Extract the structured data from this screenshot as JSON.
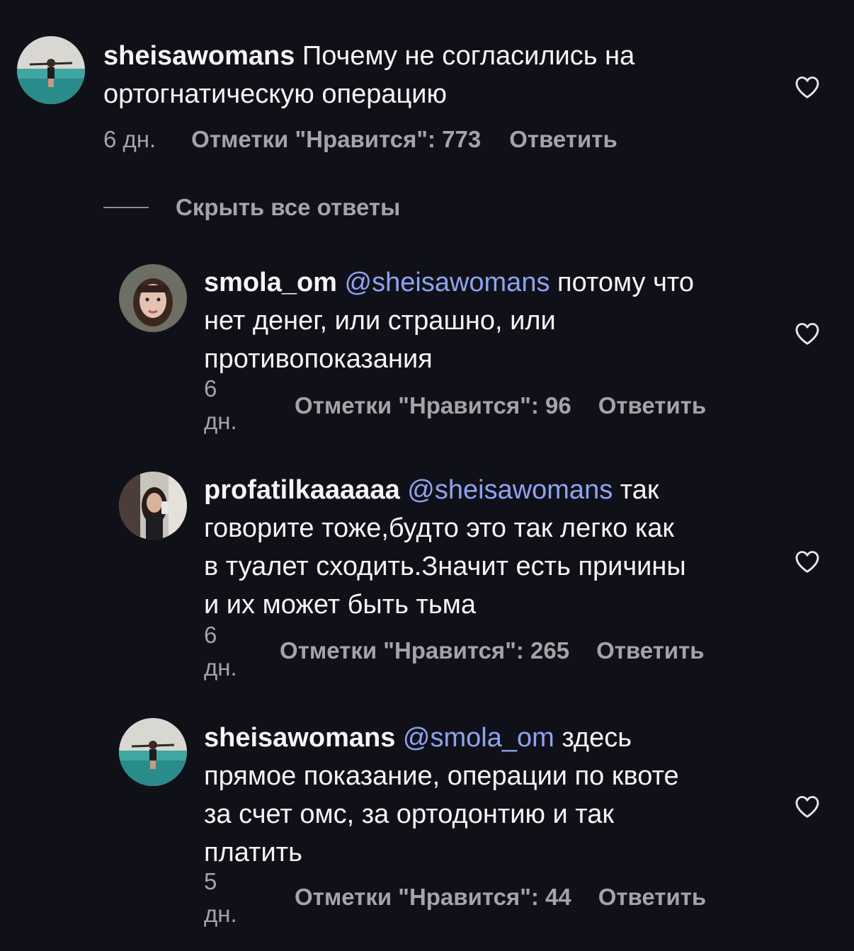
{
  "colors": {
    "background": "#101118",
    "text": "#f5f5f5",
    "secondary_text": "#a3a3a8",
    "mention": "#8fa2f2"
  },
  "comments": [
    {
      "username": "sheisawomans",
      "mention": "",
      "text_line1": "Почему не согласились на",
      "text_line2": "ортогнатическую операцию",
      "text_line3": "",
      "text_line4": "",
      "time": "6 дн.",
      "time_num": "",
      "time_unit": "",
      "likes": "Отметки \"Нравится\": 773",
      "reply": "Ответить",
      "avatar_icon": "avatar-pool-icon",
      "heart_icon": "heart-outline-icon"
    },
    {
      "username": "smola_om",
      "mention": "@sheisawomans",
      "text_line1": "потому что",
      "text_line2": "нет денег, или страшно, или",
      "text_line3": "противопоказания",
      "text_line4": "",
      "time_num": "6",
      "time_unit": "дн.",
      "likes": "Отметки \"Нравится\": 96",
      "reply": "Ответить",
      "avatar_icon": "avatar-portrait-icon",
      "heart_icon": "heart-outline-icon"
    },
    {
      "username": "profatilkaaaaaa",
      "mention": "@sheisawomans",
      "text_line1": "так",
      "text_line2": "говорите тоже,будто это так легко как",
      "text_line3": "в туалет сходить.Значит есть причины",
      "text_line4": "и их может быть тьма",
      "time_num": "6",
      "time_unit": "дн.",
      "likes": "Отметки \"Нравится\": 265",
      "reply": "Ответить",
      "avatar_icon": "avatar-selfie-icon",
      "heart_icon": "heart-outline-icon"
    },
    {
      "username": "sheisawomans",
      "mention": "@smola_om",
      "text_line1": "здесь",
      "text_line2": "прямое показание, операции по квоте",
      "text_line3": "за счет омс, за ортодонтию и так",
      "text_line4": "платить",
      "time_num": "5",
      "time_unit": "дн.",
      "likes": "Отметки \"Нравится\": 44",
      "reply": "Ответить",
      "avatar_icon": "avatar-pool-icon",
      "heart_icon": "heart-outline-icon"
    }
  ],
  "hide_replies_label": "Скрыть все ответы"
}
